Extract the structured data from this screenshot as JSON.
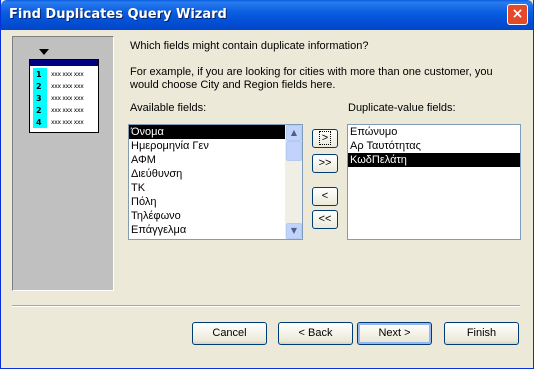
{
  "window": {
    "title": "Find Duplicates Query Wizard",
    "close_glyph": "×"
  },
  "illustration": {
    "rows": [
      "1",
      "2",
      "3",
      "2",
      "4"
    ],
    "cell_text": "xxx xxx xxx"
  },
  "question": "Which fields might contain duplicate information?",
  "example_line1": "For example, if you are looking for cities with more than one customer, you",
  "example_line2": "would choose City and Region fields here.",
  "available": {
    "label": "Available fields:",
    "items": [
      "Όνομα",
      "Ημερομηνία Γεν",
      "ΑΦΜ",
      "Διεύθυνση",
      "ΤΚ",
      "Πόλη",
      "Τηλέφωνο",
      "Επάγγελμα"
    ],
    "selected_index": 0
  },
  "duplicate": {
    "label": "Duplicate-value fields:",
    "items": [
      "Επώνυμο",
      "Αρ Ταυτότητας",
      "ΚωδΠελάτη"
    ],
    "selected_index": 2
  },
  "move_buttons": {
    "add_one": ">",
    "add_all": ">>",
    "remove_one": "<",
    "remove_all": "<<"
  },
  "buttons": {
    "cancel": "Cancel",
    "back": "< Back",
    "next": "Next >",
    "finish": "Finish"
  },
  "scroll": {
    "up_glyph": "▲",
    "down_glyph": "▼"
  }
}
